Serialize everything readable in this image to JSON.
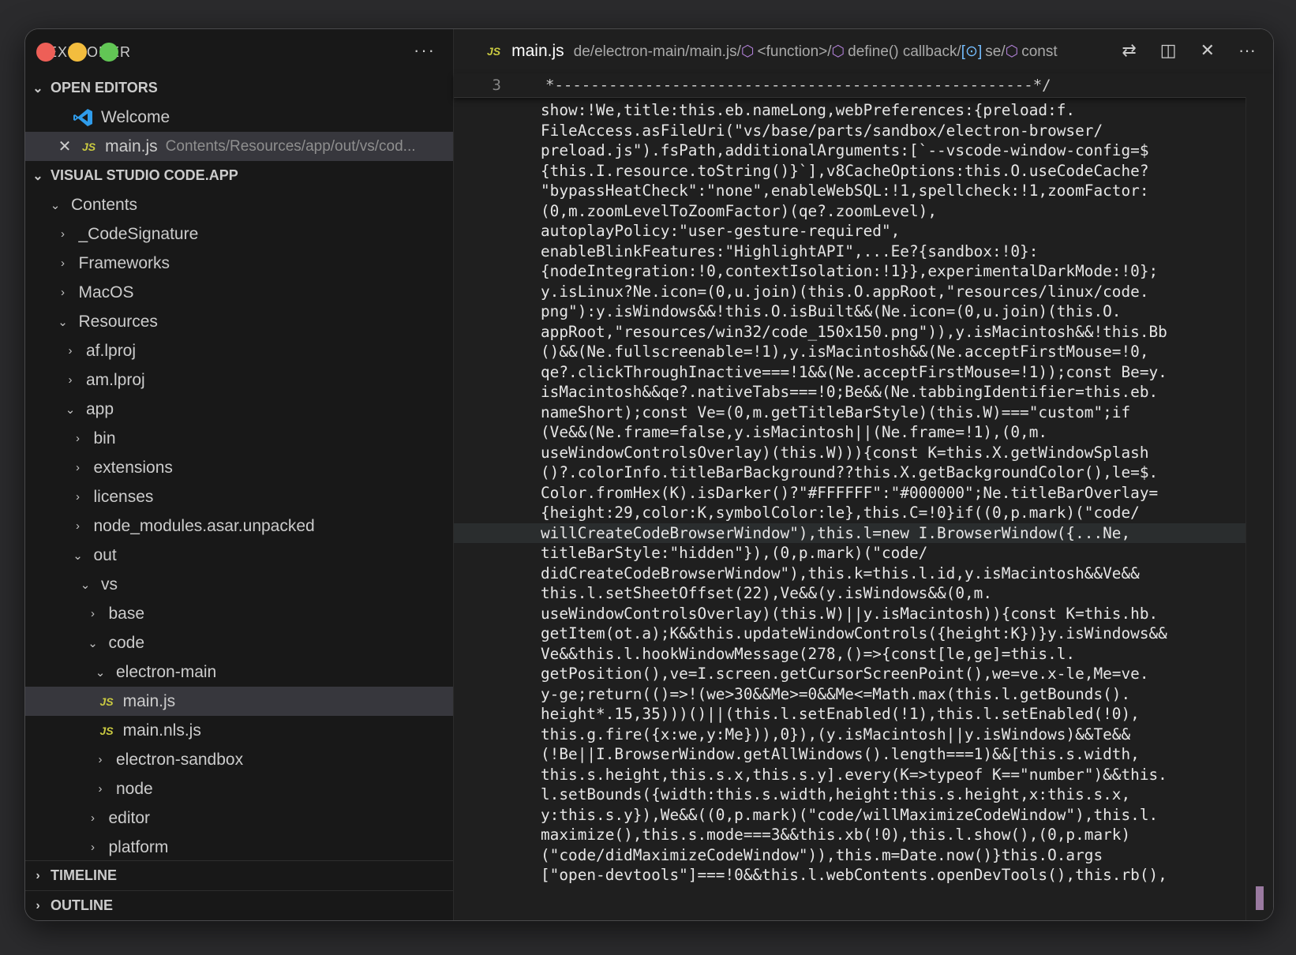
{
  "sidebar": {
    "title": "EXPLORER",
    "more_label": "···",
    "open_editors": {
      "label": "OPEN EDITORS",
      "items": [
        {
          "name": "Welcome"
        },
        {
          "name": "main.js",
          "path": "Contents/Resources/app/out/vs/cod..."
        }
      ]
    },
    "workspace": {
      "label": "VISUAL STUDIO CODE.APP",
      "tree": [
        {
          "label": "Contents",
          "depth": 0,
          "chev": "⌄"
        },
        {
          "label": "_CodeSignature",
          "depth": 1,
          "chev": "›"
        },
        {
          "label": "Frameworks",
          "depth": 1,
          "chev": "›"
        },
        {
          "label": "MacOS",
          "depth": 1,
          "chev": "›"
        },
        {
          "label": "Resources",
          "depth": 1,
          "chev": "⌄"
        },
        {
          "label": "af.lproj",
          "depth": 2,
          "chev": "›"
        },
        {
          "label": "am.lproj",
          "depth": 2,
          "chev": "›"
        },
        {
          "label": "app",
          "depth": 2,
          "chev": "⌄"
        },
        {
          "label": "bin",
          "depth": 3,
          "chev": "›"
        },
        {
          "label": "extensions",
          "depth": 3,
          "chev": "›"
        },
        {
          "label": "licenses",
          "depth": 3,
          "chev": "›"
        },
        {
          "label": "node_modules.asar.unpacked",
          "depth": 3,
          "chev": "›"
        },
        {
          "label": "out",
          "depth": 3,
          "chev": "⌄"
        },
        {
          "label": "vs",
          "depth": 4,
          "chev": "⌄"
        },
        {
          "label": "base",
          "depth": 5,
          "chev": "›"
        },
        {
          "label": "code",
          "depth": 5,
          "chev": "⌄"
        },
        {
          "label": "electron-main",
          "depth": 6,
          "chev": "⌄"
        },
        {
          "label": "main.js",
          "depth": 7,
          "file": true,
          "selected": true
        },
        {
          "label": "main.nls.js",
          "depth": 7,
          "file": true
        },
        {
          "label": "electron-sandbox",
          "depth": 6,
          "chev": "›"
        },
        {
          "label": "node",
          "depth": 6,
          "chev": "›"
        },
        {
          "label": "editor",
          "depth": 5,
          "chev": "›"
        },
        {
          "label": "platform",
          "depth": 5,
          "chev": "›"
        }
      ]
    },
    "timeline_label": "TIMELINE",
    "outline_label": "OUTLINE"
  },
  "editor": {
    "tab_icon": "JS",
    "tab_name": "main.js",
    "breadcrumb": {
      "path": "de/electron-main/main.js/",
      "items": [
        "<function>/",
        "define() callback/",
        "se/",
        "const"
      ]
    },
    "sticky_line_number": "3",
    "sticky_text": "*-----------------------------------------------------*/",
    "code_lines": [
      "show:!We,title:this.eb.nameLong,webPreferences:{preload:f.",
      "FileAccess.asFileUri(\"vs/base/parts/sandbox/electron-browser/",
      "preload.js\").fsPath,additionalArguments:[`--vscode-window-config=$",
      "{this.I.resource.toString()}`],v8CacheOptions:this.O.useCodeCache?",
      "\"bypassHeatCheck\":\"none\",enableWebSQL:!1,spellcheck:!1,zoomFactor:",
      "(0,m.zoomLevelToZoomFactor)(qe?.zoomLevel),",
      "autoplayPolicy:\"user-gesture-required\",",
      "enableBlinkFeatures:\"HighlightAPI\",...Ee?{sandbox:!0}:",
      "{nodeIntegration:!0,contextIsolation:!1}},experimentalDarkMode:!0};",
      "y.isLinux?Ne.icon=(0,u.join)(this.O.appRoot,\"resources/linux/code.",
      "png\"):y.isWindows&&!this.O.isBuilt&&(Ne.icon=(0,u.join)(this.O.",
      "appRoot,\"resources/win32/code_150x150.png\")),y.isMacintosh&&!this.Bb",
      "()&&(Ne.fullscreenable=!1),y.isMacintosh&&(Ne.acceptFirstMouse=!0,",
      "qe?.clickThroughInactive===!1&&(Ne.acceptFirstMouse=!1));const Be=y.",
      "isMacintosh&&qe?.nativeTabs===!0;Be&&(Ne.tabbingIdentifier=this.eb.",
      "nameShort);const Ve=(0,m.getTitleBarStyle)(this.W)===\"custom\";if",
      "(Ve&&(Ne.frame=false,y.isMacintosh||(Ne.frame=!1),(0,m.",
      "useWindowControlsOverlay)(this.W))){const K=this.X.getWindowSplash",
      "()?.colorInfo.titleBarBackground??this.X.getBackgroundColor(),le=$.",
      "Color.fromHex(K).isDarker()?\"#FFFFFF\":\"#000000\";Ne.titleBarOverlay=",
      "{height:29,color:K,symbolColor:le},this.C=!0}if((0,p.mark)(\"code/",
      "willCreateCodeBrowserWindow\"),this.l=new I.BrowserWindow({...Ne,",
      "titleBarStyle:\"hidden\"}),(0,p.mark)(\"code/",
      "didCreateCodeBrowserWindow\"),this.k=this.l.id,y.isMacintosh&&Ve&&",
      "this.l.setSheetOffset(22),Ve&&(y.isWindows&&(0,m.",
      "useWindowControlsOverlay)(this.W)||y.isMacintosh)){const K=this.hb.",
      "getItem(ot.a);K&&this.updateWindowControls({height:K})}y.isWindows&&",
      "Ve&&this.l.hookWindowMessage(278,()=>{const[le,ge]=this.l.",
      "getPosition(),ve=I.screen.getCursorScreenPoint(),we=ve.x-le,Me=ve.",
      "y-ge;return(()=>!(we>30&&Me>=0&&Me<=Math.max(this.l.getBounds().",
      "height*.15,35)))()||(this.l.setEnabled(!1),this.l.setEnabled(!0),",
      "this.g.fire({x:we,y:Me})),0}),(y.isMacintosh||y.isWindows)&&Te&&",
      "(!Be||I.BrowserWindow.getAllWindows().length===1)&&[this.s.width,",
      "this.s.height,this.s.x,this.s.y].every(K=>typeof K==\"number\")&&this.",
      "l.setBounds({width:this.s.width,height:this.s.height,x:this.s.x,",
      "y:this.s.y}),We&&((0,p.mark)(\"code/willMaximizeCodeWindow\"),this.l.",
      "maximize(),this.s.mode===3&&this.xb(!0),this.l.show(),(0,p.mark)",
      "(\"code/didMaximizeCodeWindow\")),this.m=Date.now()}this.O.args",
      "[\"open-devtools\"]===!0&&this.l.webContents.openDevTools(),this.rb(),"
    ],
    "highlight_line_index": 21
  }
}
